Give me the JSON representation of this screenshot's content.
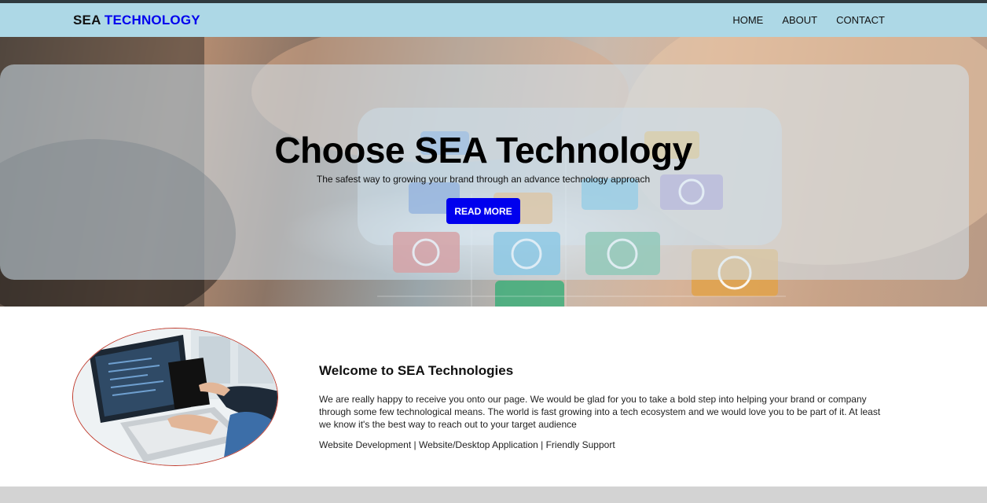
{
  "brand": {
    "part1": "SEA",
    "part2": "TECHNOLOGY"
  },
  "nav": [
    {
      "label": "HOME"
    },
    {
      "label": "ABOUT"
    },
    {
      "label": "CONTACT"
    }
  ],
  "hero": {
    "title": "Choose SEA Technology",
    "subtitle": "The safest way to growing your brand through an advance technology approach",
    "button": "READ MORE"
  },
  "welcome": {
    "title": "Welcome to SEA Technologies",
    "text": "We are really happy to receive you onto our page. We would be glad for you to take a bold step into helping your brand or company through some few technological means. The world is fast growing into a tech ecosystem and we would love you to be part of it. At least we know it's the best way to reach out to your target audience",
    "services": "Website Development | Website/Desktop Application | Friendly Support"
  },
  "colors": {
    "navbar": "#add8e6",
    "accent": "#0000ee",
    "footer": "#d3d3d3"
  }
}
